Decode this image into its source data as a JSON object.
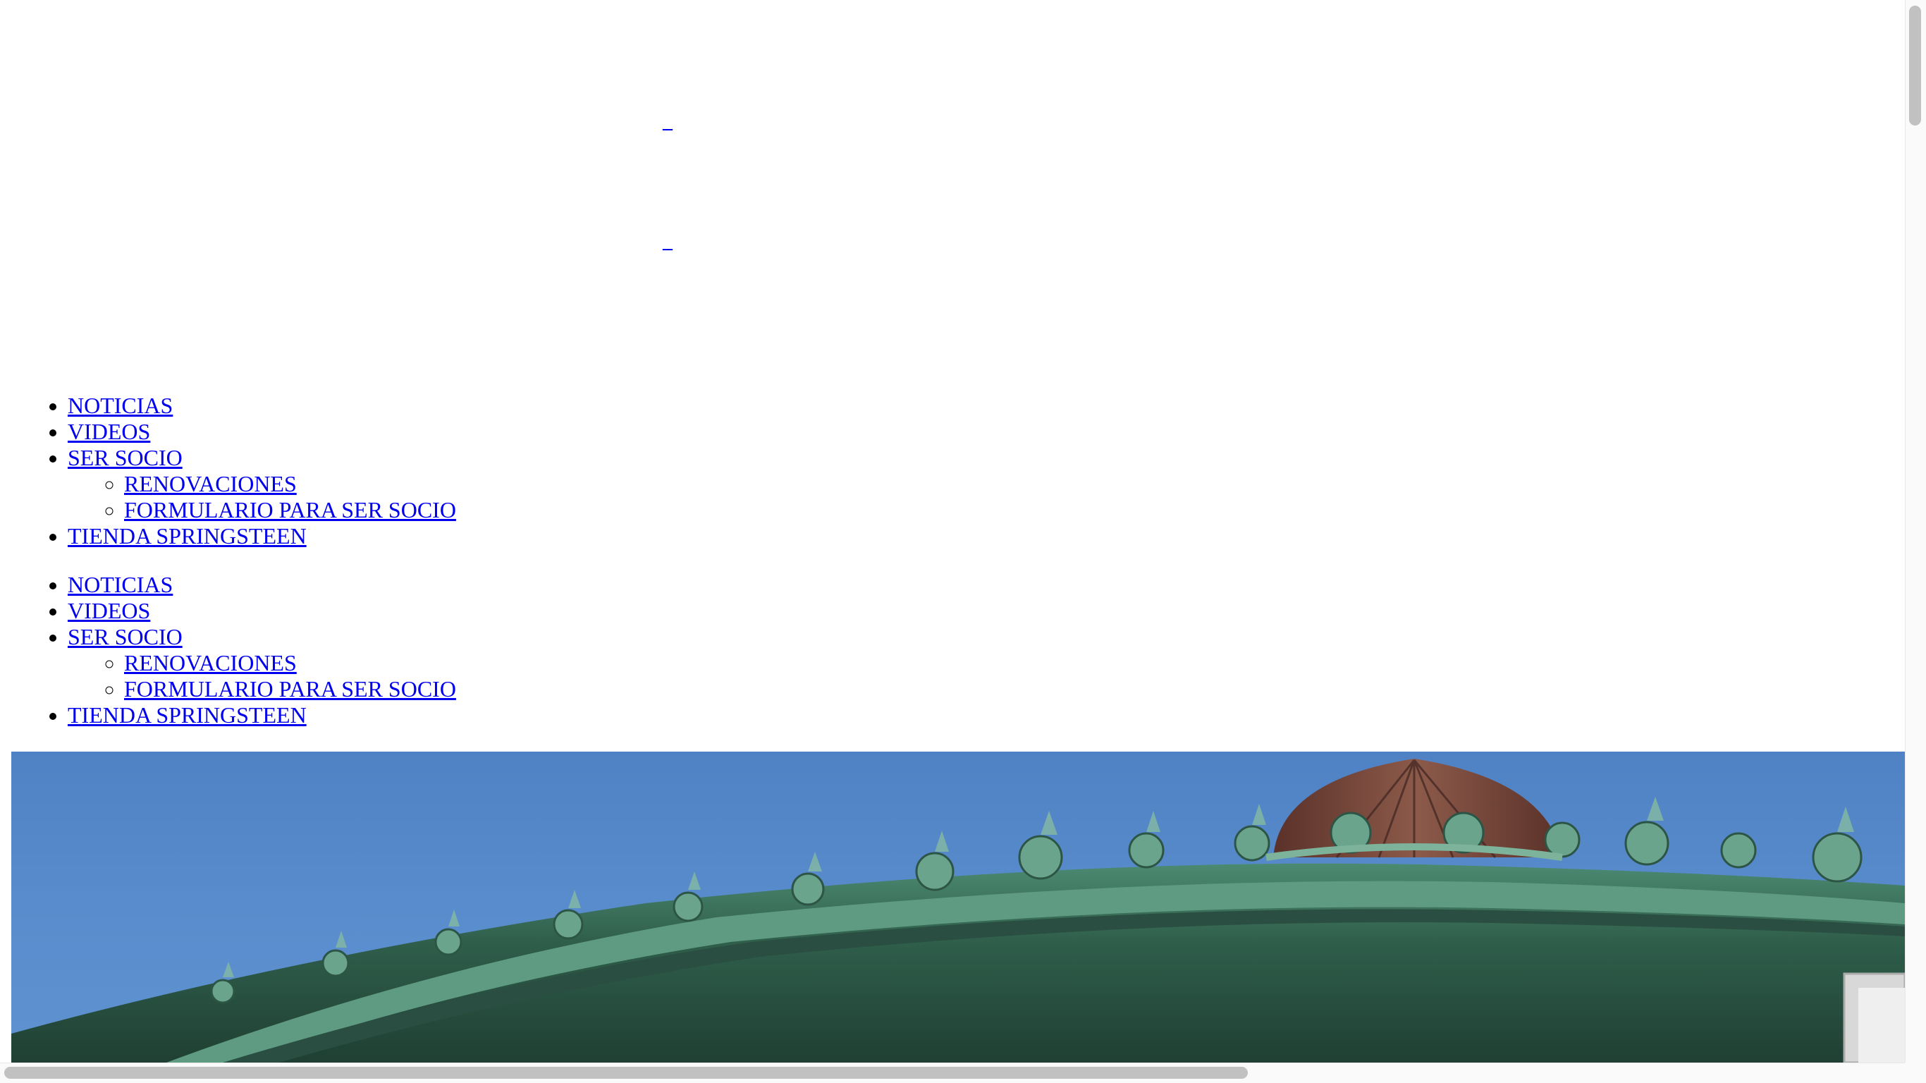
{
  "header": {
    "stub_link_1": "_",
    "stub_link_2": "_"
  },
  "nav_primary": {
    "items": [
      {
        "label": "NOTICIAS"
      },
      {
        "label": "VIDEOS"
      },
      {
        "label": "SER SOCIO",
        "children": [
          {
            "label": "RENOVACIONES"
          },
          {
            "label": "FORMULARIO PARA SER SOCIO"
          }
        ]
      },
      {
        "label": "TIENDA SPRINGSTEEN"
      }
    ]
  },
  "nav_secondary": {
    "items": [
      {
        "label": "NOTICIAS"
      },
      {
        "label": "VIDEOS"
      },
      {
        "label": "SER SOCIO",
        "children": [
          {
            "label": "RENOVACIONES"
          },
          {
            "label": "FORMULARIO PARA SER SOCIO"
          }
        ]
      },
      {
        "label": "TIENDA SPRINGSTEEN"
      }
    ]
  },
  "hero": {
    "image": "ornate-green-copper-pavilion-roof-blue-sky"
  },
  "colors": {
    "link": "#0000ee",
    "sky": "#5a8dcd",
    "copper_green": "#3f7a62",
    "dome_brown": "#7a4a3c",
    "scrollbar_thumb": "#c1c1c1"
  }
}
